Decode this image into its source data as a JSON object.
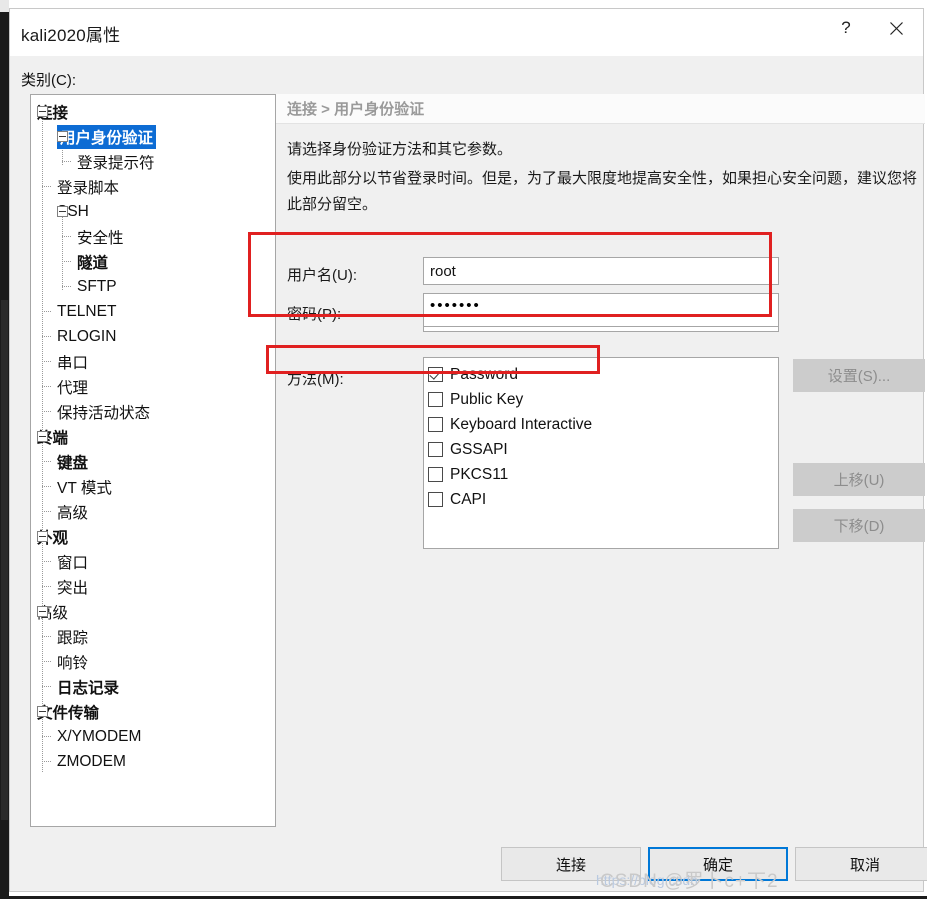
{
  "window": {
    "title": "kali2020属性",
    "help_icon": "question-mark-icon",
    "close_icon": "close-icon"
  },
  "category": {
    "label": "类别(C):"
  },
  "tree": {
    "items": [
      {
        "label": "连接",
        "level": 0,
        "bold": true,
        "selected": false,
        "expander": true
      },
      {
        "label": "用户身份验证",
        "level": 1,
        "bold": true,
        "selected": true,
        "expander": true
      },
      {
        "label": "登录提示符",
        "level": 2,
        "bold": false,
        "selected": false,
        "expander": false
      },
      {
        "label": "登录脚本",
        "level": 1,
        "bold": false,
        "selected": false,
        "expander": false
      },
      {
        "label": "SSH",
        "level": 1,
        "bold": false,
        "selected": false,
        "expander": true
      },
      {
        "label": "安全性",
        "level": 2,
        "bold": false,
        "selected": false,
        "expander": false
      },
      {
        "label": "隧道",
        "level": 2,
        "bold": true,
        "selected": false,
        "expander": false
      },
      {
        "label": "SFTP",
        "level": 2,
        "bold": false,
        "selected": false,
        "expander": false
      },
      {
        "label": "TELNET",
        "level": 1,
        "bold": false,
        "selected": false,
        "expander": false
      },
      {
        "label": "RLOGIN",
        "level": 1,
        "bold": false,
        "selected": false,
        "expander": false
      },
      {
        "label": "串口",
        "level": 1,
        "bold": false,
        "selected": false,
        "expander": false
      },
      {
        "label": "代理",
        "level": 1,
        "bold": false,
        "selected": false,
        "expander": false
      },
      {
        "label": "保持活动状态",
        "level": 1,
        "bold": false,
        "selected": false,
        "expander": false
      },
      {
        "label": "终端",
        "level": 0,
        "bold": true,
        "selected": false,
        "expander": true
      },
      {
        "label": "键盘",
        "level": 1,
        "bold": true,
        "selected": false,
        "expander": false
      },
      {
        "label": "VT 模式",
        "level": 1,
        "bold": false,
        "selected": false,
        "expander": false
      },
      {
        "label": "高级",
        "level": 1,
        "bold": false,
        "selected": false,
        "expander": false
      },
      {
        "label": "外观",
        "level": 0,
        "bold": true,
        "selected": false,
        "expander": true
      },
      {
        "label": "窗口",
        "level": 1,
        "bold": false,
        "selected": false,
        "expander": false
      },
      {
        "label": "突出",
        "level": 1,
        "bold": false,
        "selected": false,
        "expander": false
      },
      {
        "label": "高级",
        "level": 0,
        "bold": false,
        "selected": false,
        "expander": true
      },
      {
        "label": "跟踪",
        "level": 1,
        "bold": false,
        "selected": false,
        "expander": false
      },
      {
        "label": "响铃",
        "level": 1,
        "bold": false,
        "selected": false,
        "expander": false
      },
      {
        "label": "日志记录",
        "level": 1,
        "bold": true,
        "selected": false,
        "expander": false
      },
      {
        "label": "文件传输",
        "level": 0,
        "bold": true,
        "selected": false,
        "expander": true
      },
      {
        "label": "X/YMODEM",
        "level": 1,
        "bold": false,
        "selected": false,
        "expander": false
      },
      {
        "label": "ZMODEM",
        "level": 1,
        "bold": false,
        "selected": false,
        "expander": false
      }
    ]
  },
  "content": {
    "breadcrumb": "连接 > 用户身份验证",
    "description_1": "请选择身份验证方法和其它参数。",
    "description_2": "使用此部分以节省登录时间。但是，为了最大限度地提高安全性，如果担心安全问题，建议您将此部分留空。",
    "username_label": "用户名(U):",
    "username_value": "root",
    "password_label": "密码(P):",
    "password_value": "•••••••",
    "password_placeholder": "",
    "method_label": "方法(M):",
    "methods": [
      {
        "label": "Password",
        "checked": true
      },
      {
        "label": "Public Key",
        "checked": false
      },
      {
        "label": "Keyboard Interactive",
        "checked": false
      },
      {
        "label": "GSSAPI",
        "checked": false
      },
      {
        "label": "PKCS11",
        "checked": false
      },
      {
        "label": "CAPI",
        "checked": false
      }
    ],
    "side_buttons": {
      "settings": "设置(S)...",
      "move_up": "上移(U)",
      "move_down": "下移(D)"
    }
  },
  "footer": {
    "connect": "连接",
    "ok": "确定",
    "cancel": "取消"
  },
  "watermark": {
    "text": "CSDN @罗卜c+下2",
    "url": "https://blog.csdn"
  },
  "colors": {
    "accent": "#0078d7",
    "selection": "#0d6cd4",
    "annotation": "#e02020",
    "dialog_bg": "#f0f0f0",
    "disabled_btn": "#cccccc"
  }
}
